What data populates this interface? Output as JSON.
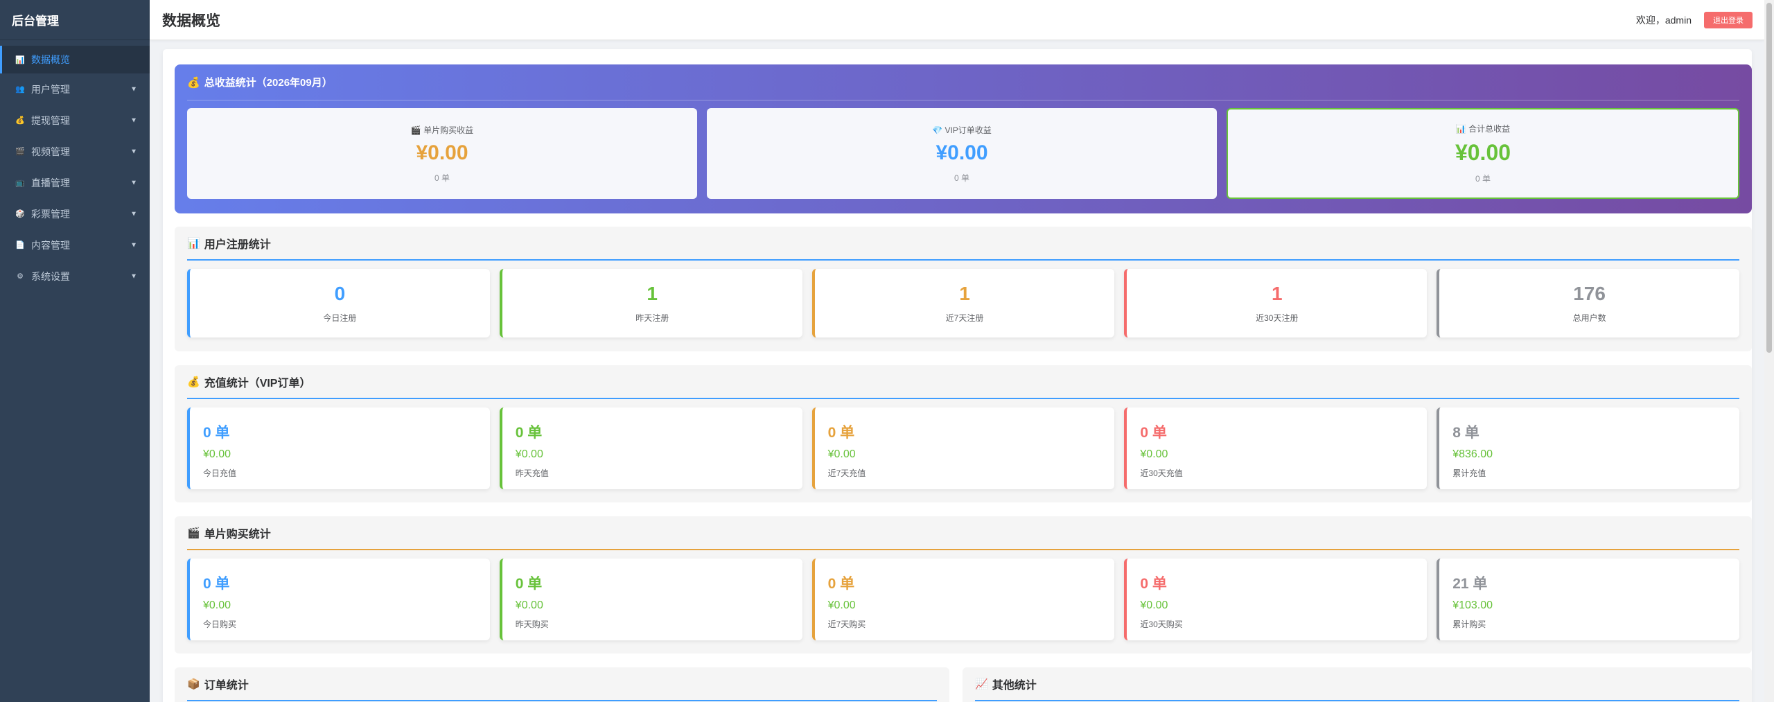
{
  "sidebar": {
    "brand": "后台管理",
    "items": [
      {
        "label": "数据概览",
        "icon": "📊",
        "icon_name": "chart-icon"
      },
      {
        "label": "用户管理",
        "icon": "👥",
        "icon_name": "users-icon"
      },
      {
        "label": "提现管理",
        "icon": "💰",
        "icon_name": "money-bag-icon"
      },
      {
        "label": "视频管理",
        "icon": "🎬",
        "icon_name": "clapper-icon"
      },
      {
        "label": "直播管理",
        "icon": "📺",
        "icon_name": "tv-icon"
      },
      {
        "label": "彩票管理",
        "icon": "🎲",
        "icon_name": "dice-icon"
      },
      {
        "label": "内容管理",
        "icon": "📄",
        "icon_name": "document-icon"
      },
      {
        "label": "系统设置",
        "icon": "⚙",
        "icon_name": "gear-icon"
      }
    ],
    "arrow": "▼"
  },
  "header": {
    "title": "数据概览",
    "welcome": "欢迎，admin",
    "logout": "退出登录"
  },
  "revenue": {
    "title": "总收益统计（2026年09月）",
    "icon": "💰",
    "cards": [
      {
        "icon": "🎬",
        "label": "单片购买收益",
        "value": "¥0.00",
        "count": "0 单",
        "color": "#e6a23c"
      },
      {
        "icon": "💎",
        "label": "VIP订单收益",
        "value": "¥0.00",
        "count": "0 单",
        "color": "#409eff"
      },
      {
        "icon": "📊",
        "label": "合计总收益",
        "value": "¥0.00",
        "count": "0 单",
        "color": "#67c23a"
      }
    ]
  },
  "registration": {
    "title": "用户注册统计",
    "icon": "📊",
    "cards": [
      {
        "value": "0",
        "label": "今日注册"
      },
      {
        "value": "1",
        "label": "昨天注册"
      },
      {
        "value": "1",
        "label": "近7天注册"
      },
      {
        "value": "1",
        "label": "近30天注册"
      },
      {
        "value": "176",
        "label": "总用户数"
      }
    ]
  },
  "recharge": {
    "title": "充值统计（VIP订单）",
    "icon": "💰",
    "cards": [
      {
        "count": "0 单",
        "amount": "¥0.00",
        "label": "今日充值"
      },
      {
        "count": "0 单",
        "amount": "¥0.00",
        "label": "昨天充值"
      },
      {
        "count": "0 单",
        "amount": "¥0.00",
        "label": "近7天充值"
      },
      {
        "count": "0 单",
        "amount": "¥0.00",
        "label": "近30天充值"
      },
      {
        "count": "8 单",
        "amount": "¥836.00",
        "label": "累计充值"
      }
    ]
  },
  "purchase": {
    "title": "单片购买统计",
    "icon": "🎬",
    "cards": [
      {
        "count": "0 单",
        "amount": "¥0.00",
        "label": "今日购买"
      },
      {
        "count": "0 单",
        "amount": "¥0.00",
        "label": "昨天购买"
      },
      {
        "count": "0 单",
        "amount": "¥0.00",
        "label": "近7天购买"
      },
      {
        "count": "0 单",
        "amount": "¥0.00",
        "label": "近30天购买"
      },
      {
        "count": "21 单",
        "amount": "¥103.00",
        "label": "累计购买"
      }
    ]
  },
  "orders": {
    "title": "订单统计",
    "icon": "📦"
  },
  "other": {
    "title": "其他统计",
    "icon": "📈"
  },
  "colors": {
    "blue": "#409eff",
    "green": "#67c23a",
    "orange": "#e6a23c",
    "red": "#f56c6c",
    "gray": "#909399",
    "banner_start": "#667eea",
    "banner_end": "#764ba2",
    "sidebar_bg": "#304156"
  }
}
